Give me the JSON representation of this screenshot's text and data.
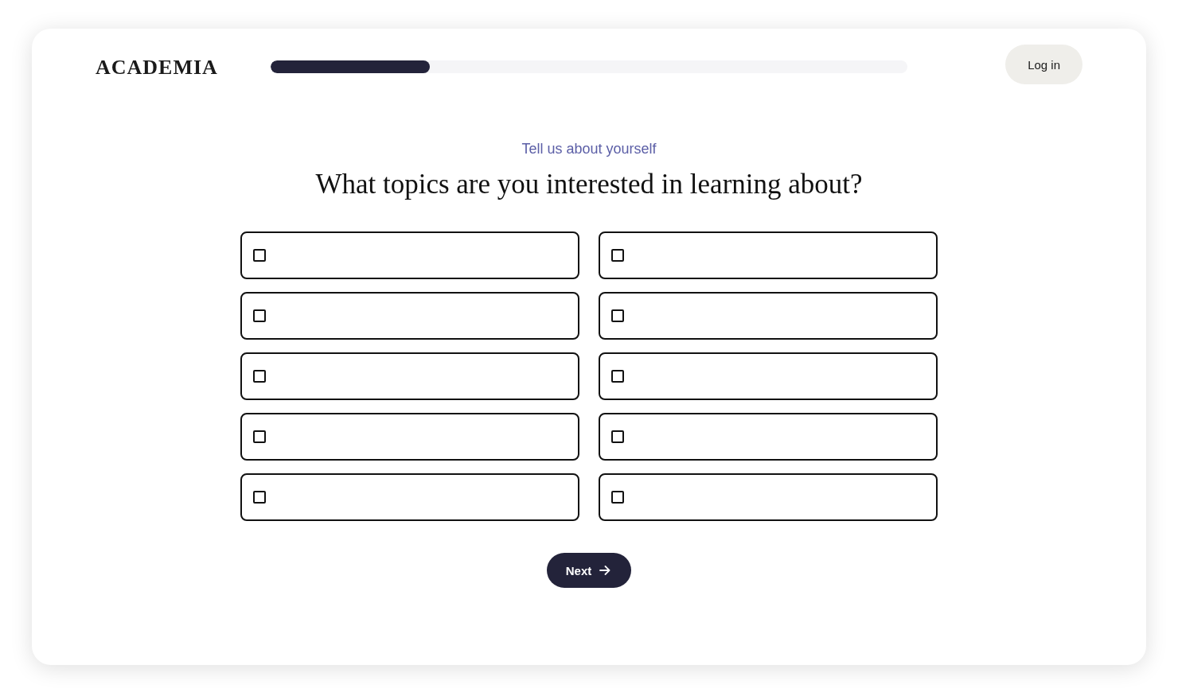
{
  "header": {
    "logo": "ACADEMIA",
    "progress": {
      "level": 0.25
    },
    "login_button": "Log in"
  },
  "subtitle": "Tell us about yourself",
  "heading": "What topics are you interested in learning about?",
  "options": [
    {
      "checked": false
    },
    {
      "checked": false
    },
    {
      "checked": false
    },
    {
      "checked": false
    },
    {
      "checked": false
    },
    {
      "checked": false
    },
    {
      "checked": false
    },
    {
      "checked": false
    },
    {
      "checked": false
    },
    {
      "checked": false
    }
  ],
  "next_button": "Next"
}
